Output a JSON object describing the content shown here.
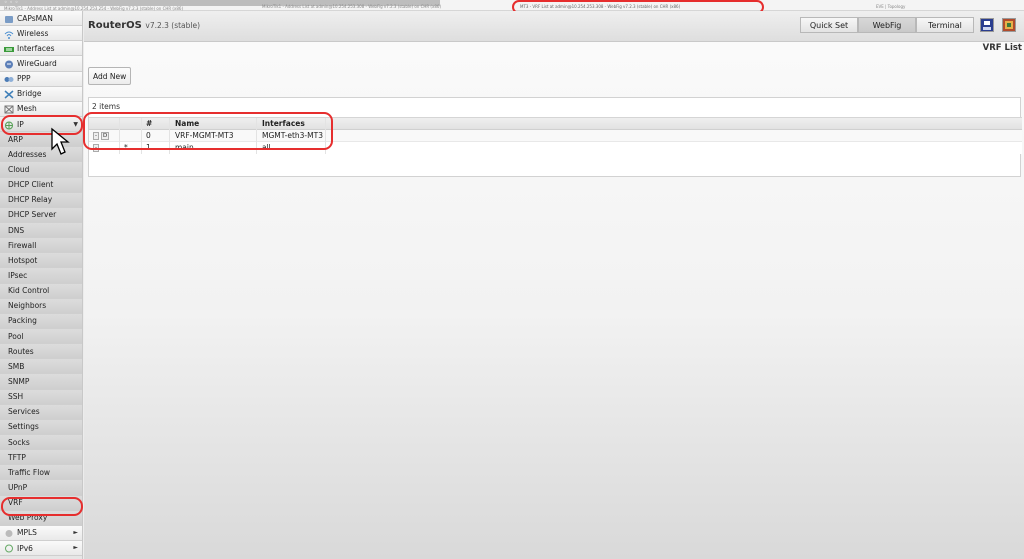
{
  "browser": {
    "tabs": [
      "MikroTik1 - Address List at admin@10.254.253.254 - WebFig v7.2.3 (stable) on CHR (x86)",
      "MikroTik1 - Address List at admin@10.254.253.308 - WebFig v7.2.3 (stable) on CHR (x86)",
      "MT3 - VRF List at admin@10.254.253.308 - WebFig v7.2.3 (stable) on CHR (x86)",
      "EVE | Topology"
    ]
  },
  "sidebar": {
    "items": [
      {
        "label": "CAPsMAN",
        "icon": "capsman-icon",
        "color": "#7a9cc6"
      },
      {
        "label": "Wireless",
        "icon": "wireless-icon",
        "color": "#4c8fd0"
      },
      {
        "label": "Interfaces",
        "icon": "interfaces-icon",
        "color": "#3a9a3a"
      },
      {
        "label": "WireGuard",
        "icon": "wireguard-icon",
        "color": "#5c7fb8"
      },
      {
        "label": "PPP",
        "icon": "ppp-icon",
        "color": "#4b7bb5"
      },
      {
        "label": "Bridge",
        "icon": "bridge-icon",
        "color": "#3f7fb8"
      },
      {
        "label": "Mesh",
        "icon": "mesh-icon",
        "color": "#777777"
      },
      {
        "label": "IP",
        "icon": "ip-icon",
        "color": "#559f55",
        "arrow": "▼"
      }
    ],
    "ip_subitems": [
      "ARP",
      "Addresses",
      "Cloud",
      "DHCP Client",
      "DHCP Relay",
      "DHCP Server",
      "DNS",
      "Firewall",
      "Hotspot",
      "IPsec",
      "Kid Control",
      "Neighbors",
      "Packing",
      "Pool",
      "Routes",
      "SMB",
      "SNMP",
      "SSH",
      "Services",
      "Settings",
      "Socks",
      "TFTP",
      "Traffic Flow",
      "UPnP",
      "VRF",
      "Web Proxy"
    ],
    "bottom_items": [
      {
        "label": "MPLS",
        "icon": "mpls-icon",
        "arrow": "►"
      },
      {
        "label": "IPv6",
        "icon": "ipv6-icon",
        "arrow": "►"
      }
    ]
  },
  "header": {
    "brand": "RouterOS",
    "version": "v7.2.3 (stable)",
    "buttons": [
      "Quick Set",
      "WebFig",
      "Terminal"
    ]
  },
  "page_title": "VRF List",
  "add_button": "Add New",
  "items_count": "2 items",
  "table": {
    "columns": [
      "#",
      "Name",
      "Interfaces"
    ],
    "rows": [
      {
        "btn1": "-",
        "btn2": "D",
        "flag": "",
        "num": "0",
        "name": "VRF-MGMT-MT3",
        "interfaces": "MGMT-eth3-MT3"
      },
      {
        "btn1": "-",
        "btn2": "",
        "flag": "*",
        "num": "1",
        "name": "main",
        "interfaces": "all"
      }
    ]
  },
  "colors": {
    "highlight_ring": "#e62e2e"
  }
}
